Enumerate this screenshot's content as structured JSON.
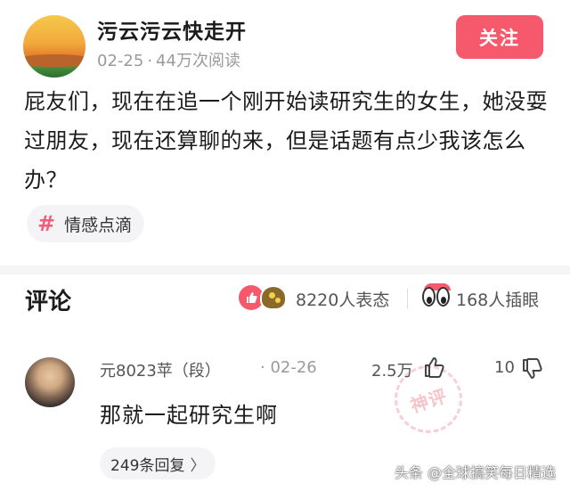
{
  "post": {
    "author_name": "污云污云快走开",
    "date": "02-25",
    "views": "44万次阅读",
    "follow_label": "关注",
    "body": "屁友们，现在在追一个刚开始读研究生的女生，她没耍过朋友，现在还算聊的来，但是话题有点少我该怎么办？",
    "topic_tag": "情感点滴",
    "topic_icon": "hash-icon"
  },
  "comments_section": {
    "title": "评论",
    "reaction_count": "8220人表态",
    "eyes_count": "168人插眼"
  },
  "comment": {
    "user": "元8023苹（段）",
    "date": "02-26",
    "likes": "2.5万",
    "dislikes": "10",
    "text": "那就一起研究生啊",
    "replies": "249条回复",
    "reply_chevron": "〉",
    "stamp_text": "神评"
  },
  "watermark": "头条 @全球搞笑每日精选",
  "colors": {
    "accent": "#f6596b",
    "tag_hash": "#f25d79"
  }
}
